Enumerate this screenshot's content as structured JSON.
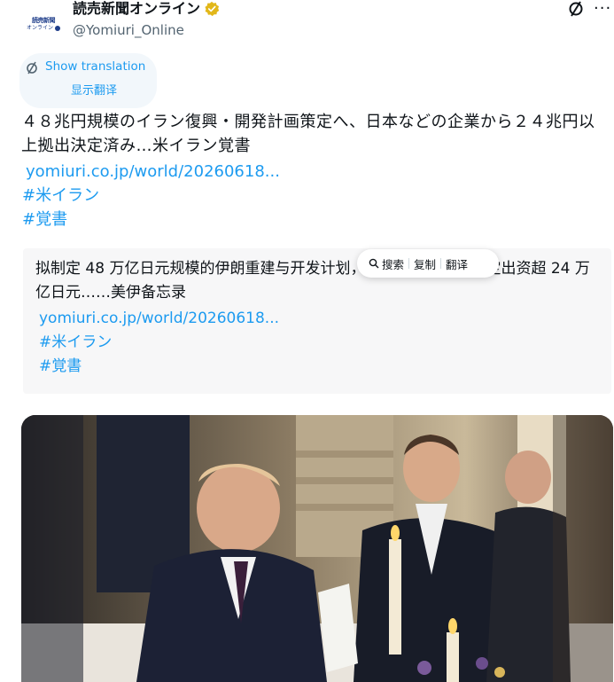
{
  "account": {
    "display_name": "読売新聞オンライン",
    "handle": "@Yomiuri_Online",
    "avatar_line1": "読売新聞",
    "avatar_line2": "オンライン"
  },
  "translation": {
    "show_label": "Show translation",
    "cn_label": "显示翻译"
  },
  "tweet": {
    "text": "４８兆円規模のイラン復興・開発計画策定へ、日本などの企業から２４兆円以上拠出決定済み…米イラン覚書",
    "link": "yomiuri.co.jp/world/20260618...",
    "hashtags": [
      "#米イラン",
      "#覚書"
    ]
  },
  "translated": {
    "text": "拟制定 48 万亿日元规模的伊朗重建与开发计划，日本等国企业已决定出资超 24 万亿日元……美伊备忘录",
    "link": "yomiuri.co.jp/world/20260618...",
    "hashtags": [
      "#米イラン",
      "#覚書"
    ]
  },
  "context_menu": {
    "search": "搜索",
    "copy": "复制",
    "translate": "翻译"
  },
  "icons": {
    "verified": "verified-badge-icon",
    "grok": "grok-icon",
    "more": "more-icon",
    "translate": "translate-icon",
    "search": "search-icon"
  },
  "colors": {
    "link": "#1d9bf0",
    "badge": "#e2b719",
    "text": "#0f1419",
    "secondary": "#536471"
  }
}
